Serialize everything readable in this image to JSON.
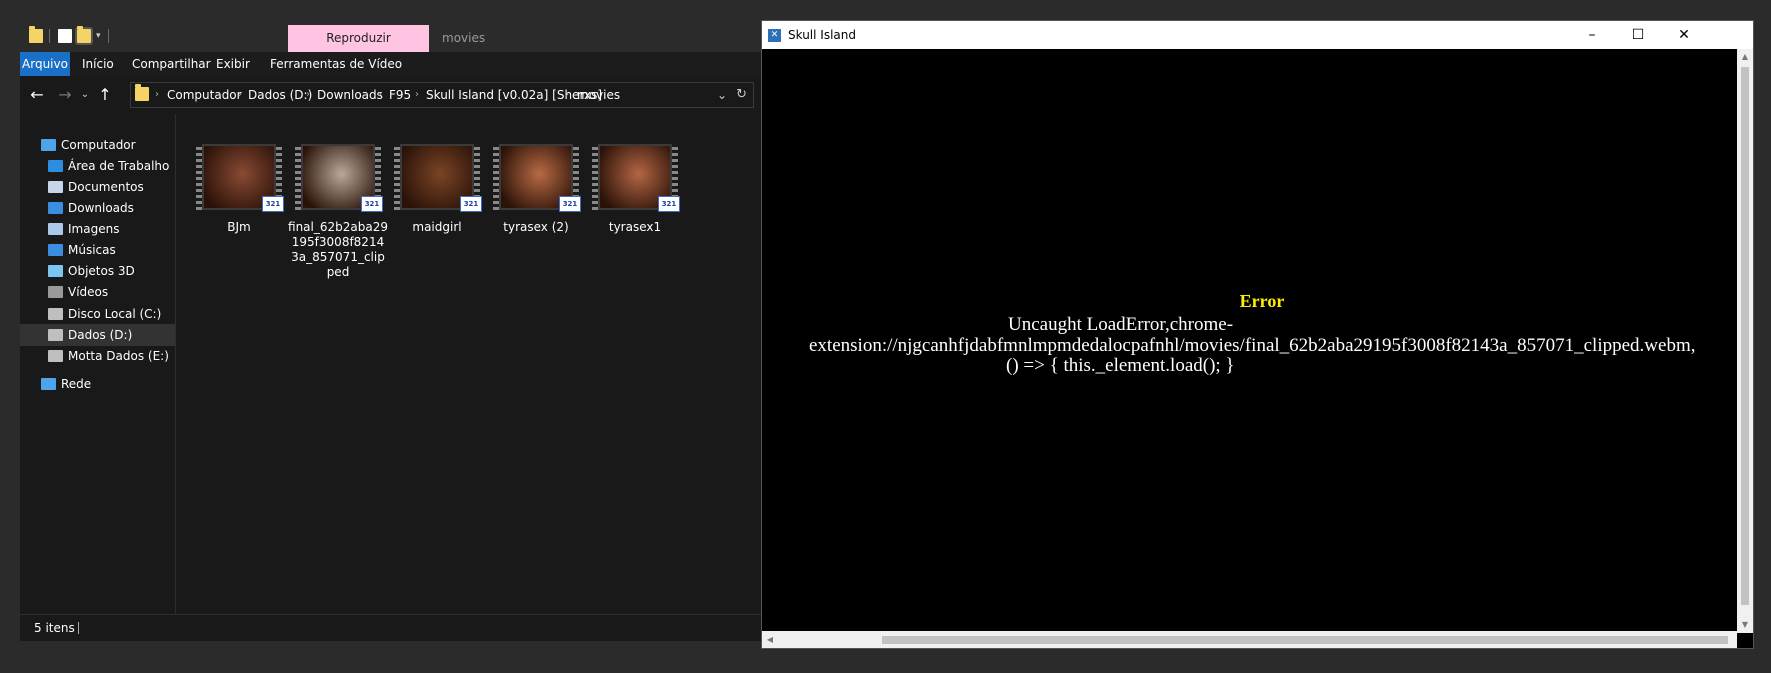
{
  "explorer": {
    "tabs": {
      "play_label": "Reproduzir",
      "folder_title": "movies"
    },
    "ribbon": [
      "Arquivo",
      "Início",
      "Compartilhar",
      "Exibir",
      "Ferramentas de Vídeo"
    ],
    "address": {
      "crumbs": [
        "Computador",
        "Dados (D:)",
        "Downloads",
        "F95",
        "Skull Island [v0.02a] [Sherxs]",
        "movies"
      ]
    },
    "nav": [
      {
        "label": "Computador",
        "icon": "computer-icon",
        "color": "#4fa3e8"
      },
      {
        "label": "Área de Trabalho",
        "icon": "desktop-icon",
        "color": "#2b8ee0"
      },
      {
        "label": "Documentos",
        "icon": "documents-icon",
        "color": "#c8d4e8"
      },
      {
        "label": "Downloads",
        "icon": "downloads-icon",
        "color": "#3a8de0"
      },
      {
        "label": "Imagens",
        "icon": "pictures-icon",
        "color": "#a9c8ea"
      },
      {
        "label": "Músicas",
        "icon": "music-icon",
        "color": "#3a8de0"
      },
      {
        "label": "Objetos 3D",
        "icon": "objects3d-icon",
        "color": "#7cc6f2"
      },
      {
        "label": "Vídeos",
        "icon": "videos-icon",
        "color": "#9a9a9a"
      },
      {
        "label": "Disco Local (C:)",
        "icon": "drive-c-icon",
        "color": "#bfbfbf"
      },
      {
        "label": "Dados (D:)",
        "icon": "drive-d-icon",
        "color": "#bfbfbf"
      },
      {
        "label": "Motta Dados (E:)",
        "icon": "drive-e-icon",
        "color": "#bfbfbf"
      },
      {
        "label": "Rede",
        "icon": "network-icon",
        "color": "#4fa3e8"
      }
    ],
    "files": [
      {
        "name": "BJm",
        "tint": "#8a4a34"
      },
      {
        "name": "final_62b2aba29195f3008f82143a_857071_clipped",
        "tint": "#b9a89a"
      },
      {
        "name": "maidgirl",
        "tint": "#7a4426"
      },
      {
        "name": "tyrasex (2)",
        "tint": "#b86a44"
      },
      {
        "name": "tyrasex1",
        "tint": "#b46644"
      }
    ],
    "file_badge": "321",
    "status": "5 itens"
  },
  "game": {
    "title": "Skull Island",
    "error_title": "Error",
    "error_lines": [
      "Uncaught LoadError,chrome-",
      "extension://njgcanhfjdabfmnlmpmdedalocpafnhl/movies/final_62b2aba29195f3008f82143a_857071_clipped.webm,",
      "() => { this._element.load(); }"
    ]
  }
}
